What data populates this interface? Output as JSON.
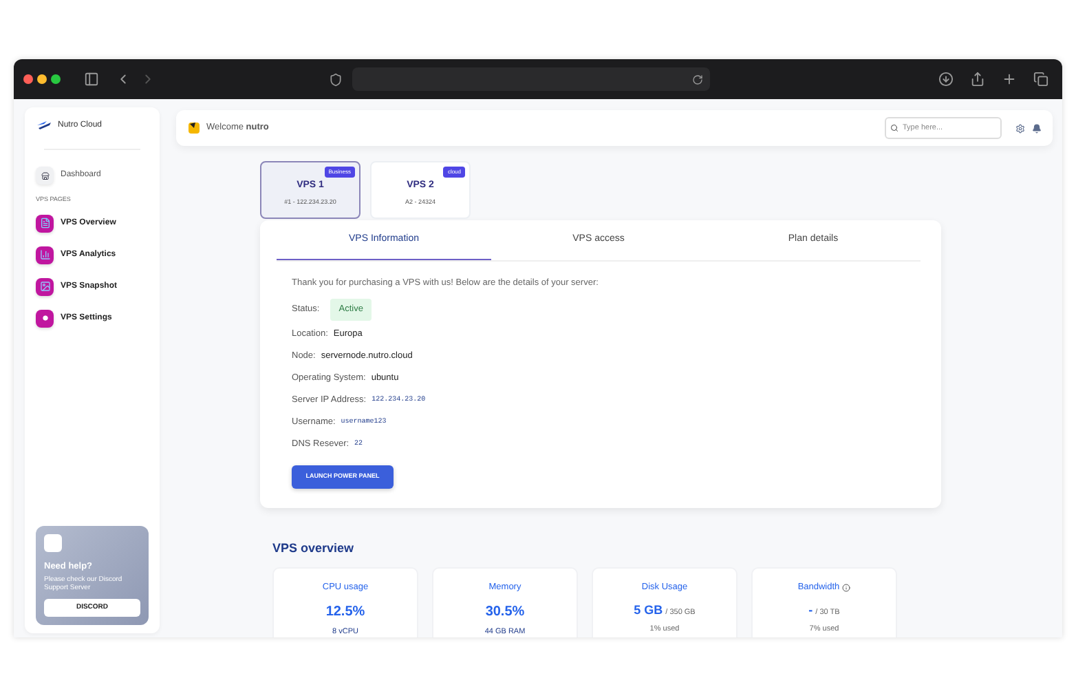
{
  "sidebar": {
    "brand": "Nutro Cloud",
    "dashboard": {
      "label": "Dashboard",
      "selected": false
    },
    "section": "VPS PAGES",
    "pages": [
      {
        "label": "VPS Overview",
        "kind": "doc",
        "selected": false
      },
      {
        "label": "VPS Analytics",
        "kind": "chart",
        "selected": false
      },
      {
        "label": "VPS Snapshot",
        "kind": "image",
        "selected": false
      },
      {
        "label": "VPS Settings",
        "kind": "gear",
        "selected": false
      }
    ],
    "help": {
      "title": "Need help?",
      "text": "Please check our Discord Support Server",
      "button": "DISCORD"
    }
  },
  "header": {
    "welcome": "Welcome **nutro**",
    "search": {
      "placeholder": "Type here..."
    }
  },
  "servers": [
    {
      "name": "VPS 1",
      "badge": "Business",
      "subtitle": "#1 - 122.234.23.20",
      "selected": true
    },
    {
      "name": "VPS 2",
      "badge": "cloud",
      "subtitle": "A2 - 24324",
      "selected": false
    }
  ],
  "tabs": [
    {
      "label": "VPS Information",
      "selected": true
    },
    {
      "label": "VPS access",
      "selected": false
    },
    {
      "label": "Plan details",
      "selected": false
    }
  ],
  "info": {
    "intro": "Thank you for purchasing a VPS with us! Below are the details of your server:",
    "status": {
      "label": "Status:",
      "value": "Active"
    },
    "fields": [
      {
        "label": "Location:",
        "value": "Europa",
        "kind": "text"
      },
      {
        "label": "Node:",
        "value": "servernode.nutro.cloud",
        "kind": "text"
      },
      {
        "label": "Operating System:",
        "value": "ubuntu",
        "kind": "text"
      },
      {
        "label": "Server IP Address:",
        "value": "122.234.23.20",
        "kind": "code"
      },
      {
        "label": "Username:",
        "value": "username123",
        "kind": "code"
      },
      {
        "label": "DNS Resever:",
        "value": "22",
        "kind": "code"
      }
    ],
    "button": "LAUNCH POWER PANEL"
  },
  "overview": {
    "title": "VPS overview",
    "cards": [
      {
        "title": "CPU usage",
        "value": "12.5%",
        "detail": "8 vCPU",
        "info_icon": false
      },
      {
        "title": "Memory",
        "value": "30.5%",
        "detail": "44 GB RAM",
        "info_icon": false
      },
      {
        "title": "Disk Usage",
        "value": "5 GB",
        "total": "/ 350 GB",
        "detail": "1% used",
        "info_icon": false
      },
      {
        "title": "Bandwidth",
        "value": "-",
        "total": "/ 30 TB",
        "detail": "7% used",
        "info_icon": true
      }
    ]
  }
}
